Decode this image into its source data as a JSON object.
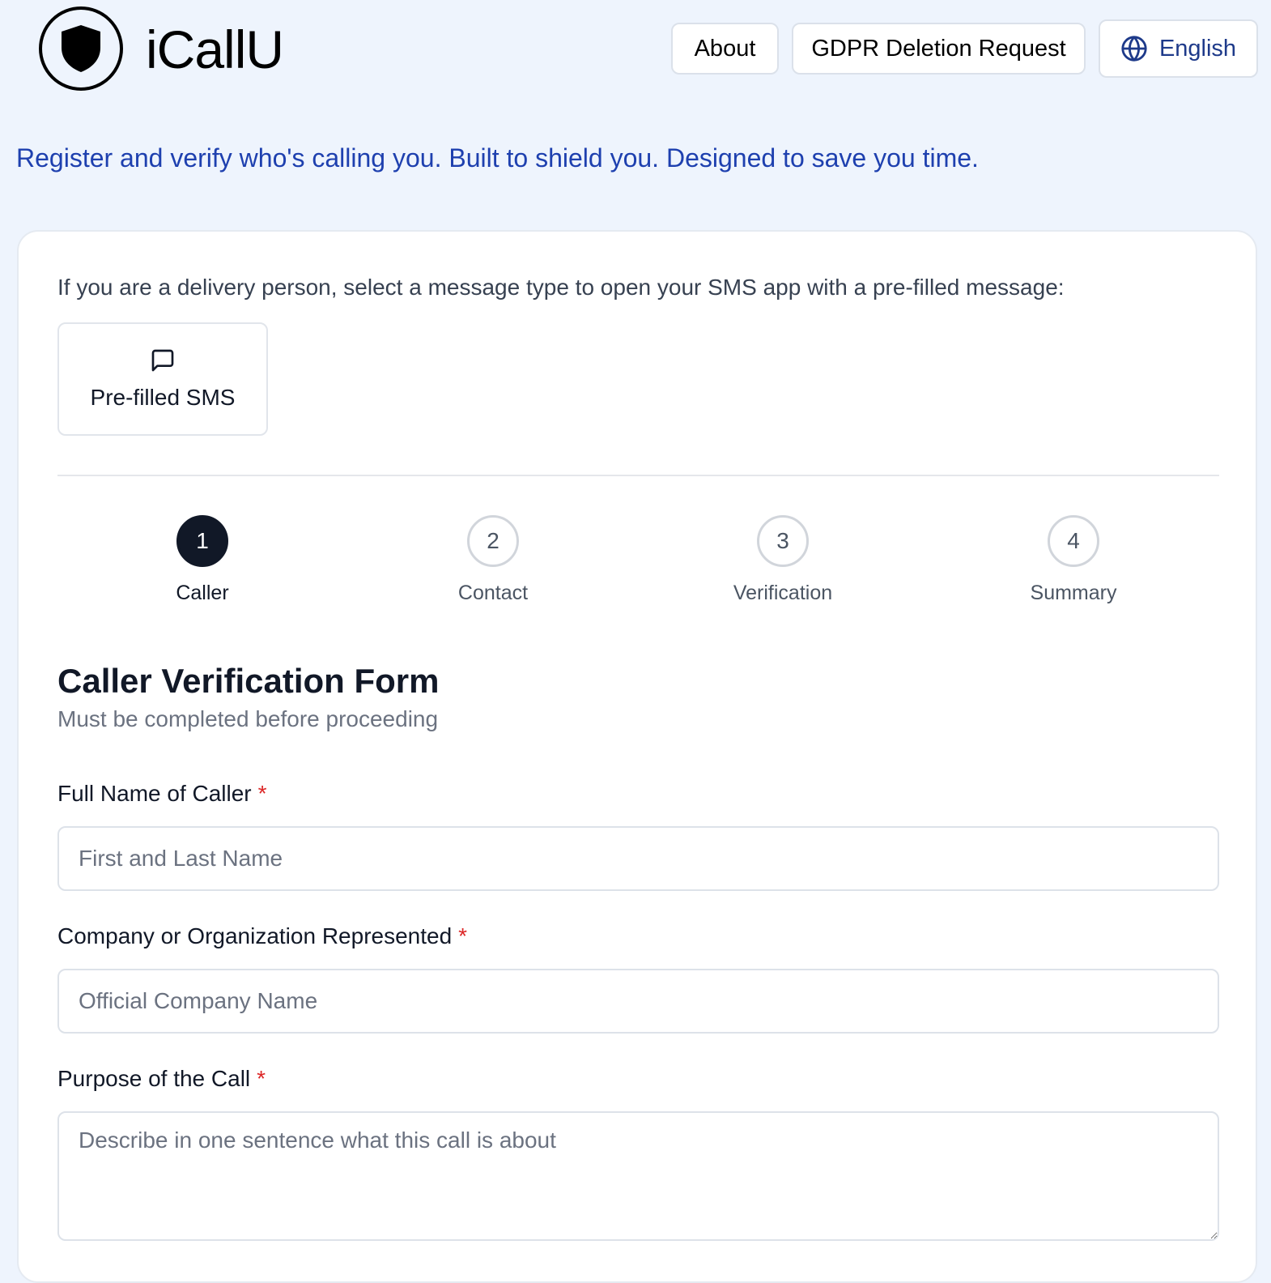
{
  "header": {
    "brand": "iCallU",
    "logo_icon": "shield-icon",
    "nav": {
      "about_label": "About",
      "gdpr_label": "GDPR Deletion Request",
      "language_label": "English",
      "language_icon": "globe-icon"
    }
  },
  "tagline": "Register and verify who's calling you. Built to shield you. Designed to save you time.",
  "sms": {
    "intro": "If you are a delivery person, select a message type to open your SMS app with a pre-filled message:",
    "button_label": "Pre-filled SMS",
    "button_icon": "message-square-icon"
  },
  "steps": [
    {
      "number": "1",
      "label": "Caller",
      "active": true
    },
    {
      "number": "2",
      "label": "Contact",
      "active": false
    },
    {
      "number": "3",
      "label": "Verification",
      "active": false
    },
    {
      "number": "4",
      "label": "Summary",
      "active": false
    }
  ],
  "form": {
    "title": "Caller Verification Form",
    "subtitle": "Must be completed before proceeding",
    "required_marker": "*",
    "fields": {
      "full_name": {
        "label": "Full Name of Caller",
        "placeholder": "First and Last Name",
        "value": ""
      },
      "company": {
        "label": "Company or Organization Represented",
        "placeholder": "Official Company Name",
        "value": ""
      },
      "purpose": {
        "label": "Purpose of the Call",
        "placeholder": "Describe in one sentence what this call is about",
        "value": ""
      }
    }
  },
  "colors": {
    "page_background": "#eef4fd",
    "accent_blue": "#1e40af",
    "active_step": "#111827",
    "required": "#dc2626"
  }
}
